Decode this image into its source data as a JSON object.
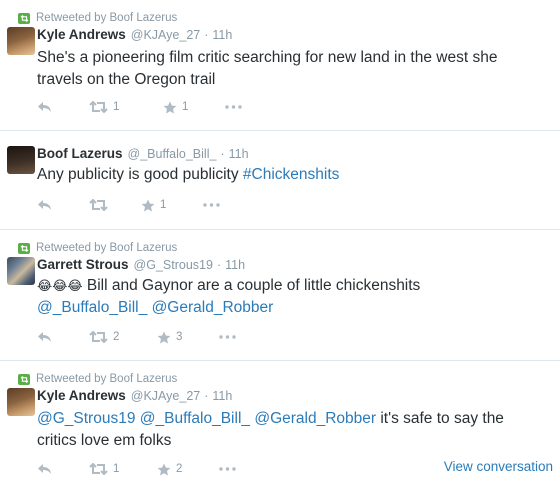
{
  "tweets": [
    {
      "retweeted_by": "Retweeted by Boof Lazerus",
      "name": "Kyle Andrews",
      "handle": "@KJAye_27",
      "dot": "·",
      "time": "11h",
      "text_line1": "She's a pioneering film critic searching for new land in the west she",
      "text_line2": "travels on the Oregon trail",
      "retweets": "1",
      "favorites": "1"
    },
    {
      "name": "Boof Lazerus",
      "handle": "@_Buffalo_Bill_",
      "dot": "·",
      "time": "11h",
      "text_plain": "Any publicity is good publicity ",
      "hashtag": "#Chickenshits",
      "retweets": "",
      "favorites": "1"
    },
    {
      "retweeted_by": "Retweeted by Boof Lazerus",
      "name": "Garrett Strous",
      "handle": "@G_Strous19",
      "dot": "·",
      "time": "11h",
      "emoji": "😂😂😂",
      "text_plain": " Bill and Gaynor are a couple of little chickenshits",
      "mention1": "@_Buffalo_Bill_",
      "mention2": "@Gerald_Robber",
      "retweets": "2",
      "favorites": "3"
    },
    {
      "retweeted_by": "Retweeted by Boof Lazerus",
      "name": "Kyle Andrews",
      "handle": "@KJAye_27",
      "dot": "·",
      "time": "11h",
      "mention1": "@G_Strous19",
      "mention2": "@_Buffalo_Bill_",
      "mention3": "@Gerald_Robber",
      "text_tail": " it's safe to say the",
      "text_line2": "critics love em folks",
      "retweets": "1",
      "favorites": "2",
      "view_conversation": "View conversation"
    }
  ],
  "colors": {
    "link": "#2b7bb9",
    "meta": "#8899a6",
    "text": "#292f33",
    "retweet_badge": "#5bae47",
    "icon": "#b1bbc3",
    "divider": "#e1e8ed"
  },
  "icons": [
    "retweet-badge-icon",
    "reply-icon",
    "retweet-icon",
    "favorite-icon",
    "more-icon"
  ]
}
